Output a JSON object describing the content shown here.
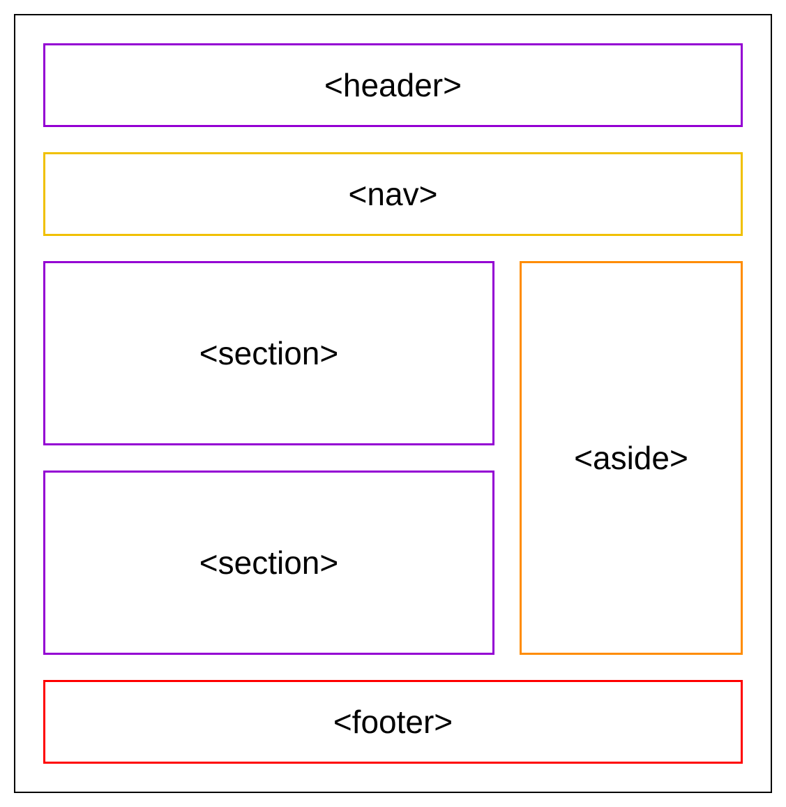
{
  "diagram": {
    "header_label": "<header>",
    "nav_label": "<nav>",
    "section1_label": "<section>",
    "section2_label": "<section>",
    "aside_label": "<aside>",
    "footer_label": "<footer>"
  },
  "colors": {
    "header_border": "#9400d3",
    "nav_border": "#f0c000",
    "section_border": "#9400d3",
    "aside_border": "#ff8c00",
    "footer_border": "#ff0000",
    "outer_border": "#000000"
  }
}
